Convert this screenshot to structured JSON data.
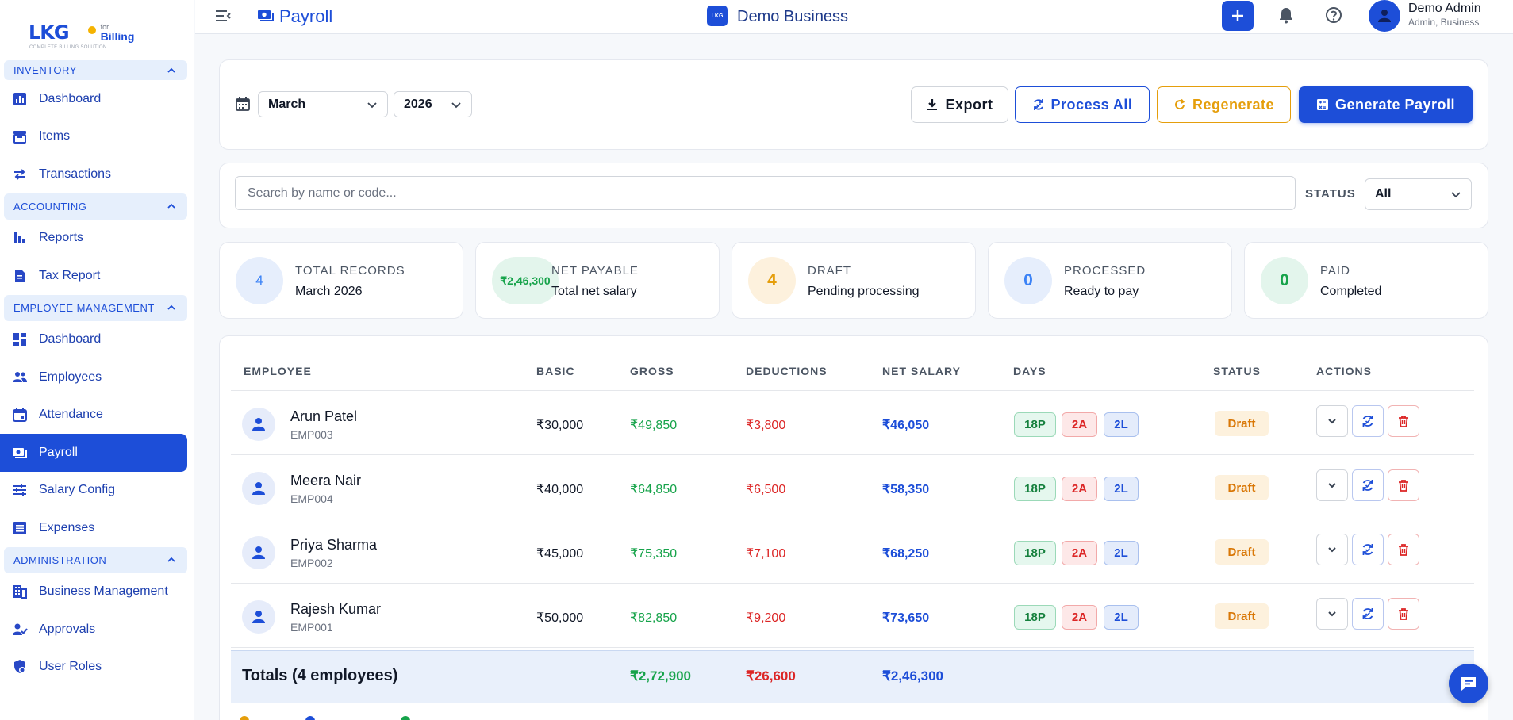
{
  "sidebar": {
    "logo": {
      "mark": "LKG",
      "for": "for",
      "brand": "Billing",
      "tagline": "COMPLETE BILLING SOLUTION"
    },
    "sections": [
      {
        "label": "INVENTORY",
        "items": [
          {
            "label": "Dashboard",
            "icon": "bar-chart-icon"
          },
          {
            "label": "Items",
            "icon": "archive-icon"
          },
          {
            "label": "Transactions",
            "icon": "swap-icon"
          }
        ]
      },
      {
        "label": "ACCOUNTING",
        "items": [
          {
            "label": "Reports",
            "icon": "bar-chart-icon"
          },
          {
            "label": "Tax Report",
            "icon": "document-icon"
          }
        ]
      },
      {
        "label": "EMPLOYEE MANAGEMENT",
        "items": [
          {
            "label": "Dashboard",
            "icon": "dashboard-icon"
          },
          {
            "label": "Employees",
            "icon": "people-icon"
          },
          {
            "label": "Attendance",
            "icon": "calendar-icon"
          },
          {
            "label": "Payroll",
            "icon": "payroll-icon",
            "active": true
          },
          {
            "label": "Salary Config",
            "icon": "sliders-icon"
          },
          {
            "label": "Expenses",
            "icon": "list-icon"
          }
        ]
      },
      {
        "label": "ADMINISTRATION",
        "items": [
          {
            "label": "Business Management",
            "icon": "building-icon"
          },
          {
            "label": "Approvals",
            "icon": "approval-icon"
          },
          {
            "label": "User Roles",
            "icon": "shield-icon"
          }
        ]
      }
    ]
  },
  "topbar": {
    "page_title": "Payroll",
    "business_name": "Demo Business",
    "business_logo_text": "LKG",
    "user_name": "Demo Admin",
    "user_role": "Admin, Business"
  },
  "filters": {
    "month": "March",
    "year": "2026",
    "export_label": "Export",
    "process_all_label": "Process All",
    "regenerate_label": "Regenerate",
    "generate_label": "Generate Payroll"
  },
  "search": {
    "placeholder": "Search by name or code...",
    "status_label": "STATUS",
    "status_value": "All"
  },
  "stats": [
    {
      "value": "4",
      "label": "TOTAL RECORDS",
      "sub": "March 2026",
      "color": "#3b82f6",
      "bg": "#e6eefc"
    },
    {
      "value": "₹2,46,300",
      "label": "NET PAYABLE",
      "sub": "Total net salary",
      "color": "#16a34a",
      "bg": "#e3f5ec"
    },
    {
      "value": "4",
      "label": "DRAFT",
      "sub": "Pending processing",
      "color": "#e59e0b",
      "bg": "#fdf1dd"
    },
    {
      "value": "0",
      "label": "PROCESSED",
      "sub": "Ready to pay",
      "color": "#3b82f6",
      "bg": "#e6eefc"
    },
    {
      "value": "0",
      "label": "PAID",
      "sub": "Completed",
      "color": "#16a34a",
      "bg": "#e3f5ec"
    }
  ],
  "table": {
    "headers": {
      "employee": "EMPLOYEE",
      "basic": "BASIC",
      "gross": "GROSS",
      "deductions": "DEDUCTIONS",
      "net": "NET SALARY",
      "days": "DAYS",
      "status": "STATUS",
      "actions": "ACTIONS"
    },
    "rows": [
      {
        "name": "Arun Patel",
        "code": "EMP003",
        "basic": "₹30,000",
        "gross": "₹49,850",
        "deductions": "₹3,800",
        "net": "₹46,050",
        "present": "18P",
        "absent": "2A",
        "leave": "2L",
        "status": "Draft"
      },
      {
        "name": "Meera Nair",
        "code": "EMP004",
        "basic": "₹40,000",
        "gross": "₹64,850",
        "deductions": "₹6,500",
        "net": "₹58,350",
        "present": "18P",
        "absent": "2A",
        "leave": "2L",
        "status": "Draft"
      },
      {
        "name": "Priya Sharma",
        "code": "EMP002",
        "basic": "₹45,000",
        "gross": "₹75,350",
        "deductions": "₹7,100",
        "net": "₹68,250",
        "present": "18P",
        "absent": "2A",
        "leave": "2L",
        "status": "Draft"
      },
      {
        "name": "Rajesh Kumar",
        "code": "EMP001",
        "basic": "₹50,000",
        "gross": "₹82,850",
        "deductions": "₹9,200",
        "net": "₹73,650",
        "present": "18P",
        "absent": "2A",
        "leave": "2L",
        "status": "Draft"
      }
    ],
    "totals": {
      "label": "Totals (4 employees)",
      "gross": "₹2,72,900",
      "deductions": "₹26,600",
      "net": "₹2,46,300"
    }
  },
  "colors": {
    "primary": "#1d4ed8",
    "success": "#16a34a",
    "danger": "#dc2626",
    "warning": "#e59e0b"
  }
}
